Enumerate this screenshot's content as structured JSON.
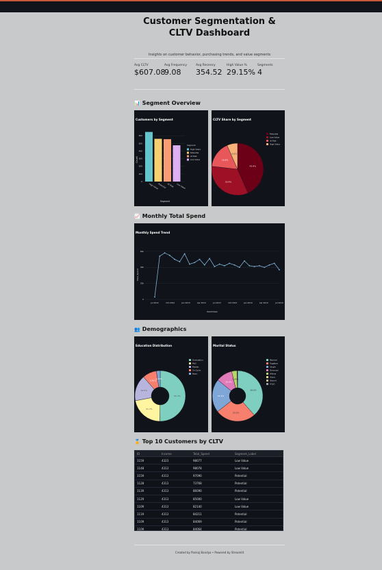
{
  "header": {
    "title": "Customer Segmentation & CLTV Dashboard",
    "subtitle": "Insights on customer behavior, purchasing trends, and value segments"
  },
  "metrics": [
    {
      "label": "Avg CLTV",
      "value": "$607.08"
    },
    {
      "label": "Avg Frequency",
      "value": "9.08"
    },
    {
      "label": "Avg Recency",
      "value": "354.52"
    },
    {
      "label": "High Value %",
      "value": "29.15%"
    },
    {
      "label": "Segments",
      "value": "4"
    }
  ],
  "sections": {
    "segment_overview": {
      "icon": "📊",
      "title": "Segment Overview"
    },
    "monthly_spend": {
      "icon": "📈",
      "title": "Monthly Total Spend"
    },
    "demographics": {
      "icon": "👥",
      "title": "Demographics"
    },
    "top_customers": {
      "icon": "🏅",
      "title": "Top 10 Customers by CLTV"
    }
  },
  "colors": {
    "teal": "#66c5cc",
    "orange": "#f6cf71",
    "salmon": "#f89c74",
    "lilac": "#dcb0f2",
    "darkred": "#6b0016",
    "red": "#c0392b",
    "pinkred": "#e8585a",
    "peach": "#f7b27a",
    "mint": "#7ecfbf",
    "yellow": "#fff5a0",
    "lavender": "#b7b4de",
    "coral": "#f67f6e",
    "blue": "#7ea6d6"
  },
  "chart_data": [
    {
      "type": "bar",
      "title": "Customers by Segment",
      "xlabel": "Segment",
      "ylabel": "Count",
      "categories": [
        "High Value",
        "Potential",
        "At Risk",
        "Low Value"
      ],
      "values": [
        650,
        560,
        555,
        475
      ],
      "ylim": [
        0,
        700
      ],
      "yticks": [
        0,
        100,
        200,
        300,
        400,
        500,
        600
      ],
      "legend_title": "Segment",
      "legend": [
        "High Value",
        "Potential",
        "At Risk",
        "Low Value"
      ],
      "legend_position": "right"
    },
    {
      "type": "pie",
      "title": "CLTV Share by Segment",
      "labels": [
        "Potential",
        "Low Value",
        "At Risk",
        "High Value"
      ],
      "values": [
        43.4,
        33.4,
        16.6,
        6.6
      ],
      "slice_labels": [
        "43.4%",
        "33.4%",
        "16.6%",
        "6.6%"
      ],
      "legend_position": "right"
    },
    {
      "type": "line",
      "title": "Monthly Spend Trend",
      "xlabel": "MonthYear",
      "ylabel": "Total_Spend",
      "x": [
        "2012-07",
        "2012-08",
        "2012-09",
        "2012-10",
        "2012-11",
        "2012-12",
        "2013-01",
        "2013-02",
        "2013-03",
        "2013-04",
        "2013-05",
        "2013-06",
        "2013-07",
        "2013-08",
        "2013-09",
        "2013-10",
        "2013-11",
        "2013-12",
        "2014-01",
        "2014-02",
        "2014-03",
        "2014-04",
        "2014-05",
        "2014-06",
        "2014-07"
      ],
      "values": [
        3000,
        54000,
        58000,
        55000,
        50000,
        47000,
        57000,
        44000,
        46000,
        50000,
        43000,
        51000,
        41000,
        44000,
        42000,
        45000,
        43000,
        40000,
        48000,
        42000,
        41000,
        42000,
        40000,
        43000,
        45000,
        37000
      ],
      "xticks": [
        "Jul 2012",
        "Oct 2012",
        "Jan 2013",
        "Apr 2013",
        "Jul 2013",
        "Oct 2013",
        "Jan 2014",
        "Apr 2014",
        "Jul 2014"
      ],
      "yticks": [
        "0",
        "20k",
        "40k",
        "60k"
      ],
      "ylim": [
        0,
        65000
      ]
    },
    {
      "type": "pie",
      "title": "Education Distribution",
      "labels": [
        "Graduation",
        "PhD",
        "Master",
        "2n Cycle",
        "Basic"
      ],
      "values": [
        50.3,
        21.7,
        16.5,
        9.06,
        2.43
      ],
      "slice_labels": [
        "50.3%",
        "21.7%",
        "16.5%",
        "9.06%",
        "2.43%"
      ],
      "legend_position": "right"
    },
    {
      "type": "pie",
      "title": "Marital Status",
      "labels": [
        "Married",
        "Together",
        "Single",
        "Divorced",
        "Widow",
        "Alone",
        "Absurd",
        "YOLO"
      ],
      "values": [
        38.6,
        25.9,
        21.4,
        10.4,
        3.44,
        0.134,
        0.0893,
        0.0893
      ],
      "slice_labels": [
        "38.6%",
        "25.9%",
        "21.4%",
        "10.4%",
        "3.44%",
        "0.134%",
        "0.0893%",
        "0.0893%"
      ],
      "legend_position": "right"
    }
  ],
  "table": {
    "columns": [
      "ID",
      "Income",
      "Total_Spend",
      "Segment_Label"
    ],
    "rows": [
      [
        "1159",
        "4323",
        "98077",
        "Low Value"
      ],
      [
        "1148",
        "4313",
        "98078",
        "Low Value"
      ],
      [
        "1159",
        "4313",
        "97090",
        "Potential"
      ],
      [
        "1128",
        "4313",
        "73768",
        "Potential"
      ],
      [
        "1139",
        "4313",
        "86090",
        "Potential"
      ],
      [
        "1129",
        "4313",
        "85000",
        "Low Value"
      ],
      [
        "1109",
        "4313",
        "82140",
        "Low Value"
      ],
      [
        "1119",
        "4313",
        "84211",
        "Potential"
      ],
      [
        "1109",
        "4313",
        "84069",
        "Potential"
      ],
      [
        "1109",
        "4313",
        "84064",
        "Potential"
      ]
    ]
  },
  "footer": {
    "text": "Created by Pankaj Bandya • Powered by Streamlit"
  }
}
